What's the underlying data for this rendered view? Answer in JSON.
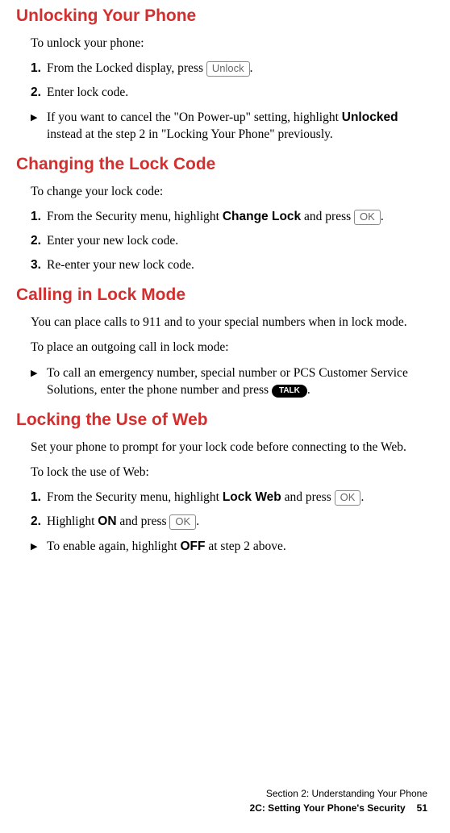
{
  "sections": [
    {
      "heading": "Unlocking Your Phone",
      "intro": "To unlock your phone:",
      "items": [
        {
          "type": "step",
          "num": "1.",
          "pre": "From the Locked display, press ",
          "key": "Unlock",
          "post": "."
        },
        {
          "type": "step",
          "num": "2.",
          "pre": "Enter lock code."
        },
        {
          "type": "bullet",
          "pre": "If you want to cancel the \"On Power-up\" setting, highlight ",
          "bold": "Unlocked",
          "post": " instead at the step 2 in \"Locking Your Phone\" previously."
        }
      ]
    },
    {
      "heading": "Changing the Lock Code",
      "intro": "To change your lock code:",
      "items": [
        {
          "type": "step",
          "num": "1.",
          "pre": "From the Security menu, highlight ",
          "bold": "Change Lock",
          "mid": " and press ",
          "key": "OK",
          "post": "."
        },
        {
          "type": "step",
          "num": "2.",
          "pre": "Enter your new lock code."
        },
        {
          "type": "step",
          "num": "3.",
          "pre": "Re-enter your new lock code."
        }
      ]
    },
    {
      "heading": "Calling in Lock Mode",
      "intro": "You can place calls to 911 and to your special numbers when in lock mode.",
      "intro2": "To place an outgoing call in lock mode:",
      "items": [
        {
          "type": "bullet",
          "pre": "To call an emergency number, special number or PCS Customer Service Solutions, enter the phone number and press ",
          "talk": "TALK",
          "post": "."
        }
      ]
    },
    {
      "heading": "Locking the Use of Web",
      "intro": "Set your phone to prompt for your lock code before connecting to the Web.",
      "intro2": "To lock the use of Web:",
      "items": [
        {
          "type": "step",
          "num": "1.",
          "pre": "From the Security menu, highlight ",
          "bold": "Lock Web",
          "mid": " and press ",
          "key": "OK",
          "post": "."
        },
        {
          "type": "step",
          "num": "2.",
          "pre": "Highlight ",
          "bold": "ON",
          "mid": " and press ",
          "key": "OK",
          "post": "."
        },
        {
          "type": "bullet",
          "pre": "To enable again, highlight ",
          "bold": "OFF",
          "post": " at step 2 above."
        }
      ]
    }
  ],
  "footer": {
    "line1": "Section 2: Understanding Your Phone",
    "line2": "2C: Setting Your Phone's Security",
    "page": "51"
  }
}
